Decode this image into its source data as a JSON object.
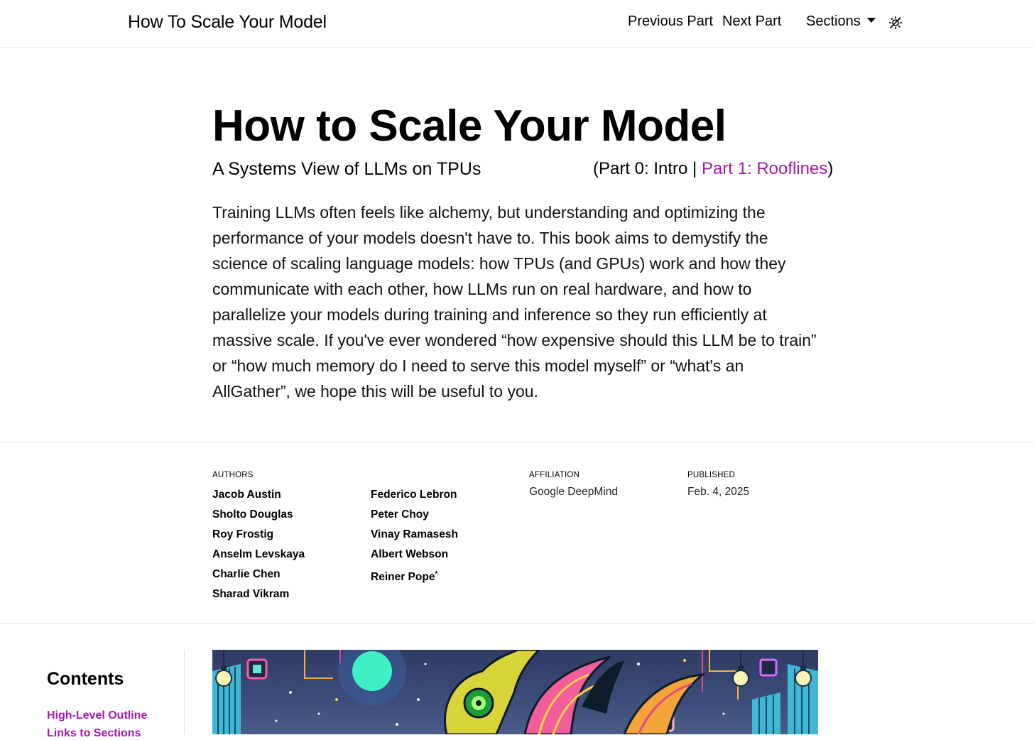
{
  "navbar": {
    "brand": "How To Scale Your Model",
    "previous": "Previous Part",
    "next": "Next Part",
    "sections": "Sections",
    "theme_icon": "theme-toggle-icon"
  },
  "header": {
    "title": "How to Scale Your Model",
    "subtitle": "A Systems View of LLMs on TPUs",
    "part_open": "(Part 0: Intro | ",
    "part_link": "Part 1: Rooflines",
    "part_close": ")",
    "intro": "Training LLMs often feels like alchemy, but understanding and optimizing the performance of your models doesn't have to. This book aims to demystify the science of scaling language models: how TPUs (and GPUs) work and how they communicate with each other, how LLMs run on real hardware, and how to parallelize your models during training and inference so they run efficiently at massive scale. If you've ever wondered “how expensive should this LLM be to train” or “how much memory do I need to serve this model myself” or “what's an AllGather”, we hope this will be useful to you."
  },
  "byline": {
    "authors_label": "AUTHORS",
    "authors_col1": [
      "Jacob Austin",
      "Sholto Douglas",
      "Roy Frostig",
      "Anselm Levskaya",
      "Charlie Chen",
      "Sharad Vikram"
    ],
    "authors_col2": [
      "Federico Lebron",
      "Peter Choy",
      "Vinay Ramasesh",
      "Albert Webson",
      "Reiner Pope"
    ],
    "reiner_mark": "*",
    "affiliation_label": "AFFILIATION",
    "affiliation": "Google DeepMind",
    "published_label": "PUBLISHED",
    "published": "Feb. 4, 2025"
  },
  "toc": {
    "title": "Contents",
    "items": [
      "High-Level Outline",
      "Links to Sections"
    ]
  },
  "colors": {
    "link": "#a41aa9",
    "divider": "#e3e3e3"
  }
}
